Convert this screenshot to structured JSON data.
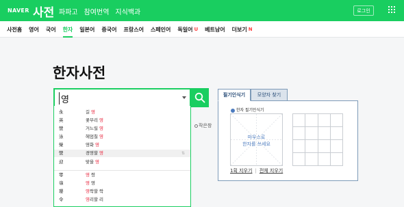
{
  "header": {
    "logo": "NAVER",
    "service": "사전",
    "nav": [
      "파파고",
      "참여번역",
      "지식백과"
    ],
    "login": "로그인"
  },
  "subnav": {
    "items": [
      {
        "label": "사전홈"
      },
      {
        "label": "영어"
      },
      {
        "label": "국어"
      },
      {
        "label": "한자",
        "active": true
      },
      {
        "label": "일본어"
      },
      {
        "label": "중국어"
      },
      {
        "label": "프랑스어"
      },
      {
        "label": "스페인어"
      },
      {
        "label": "독일어",
        "badge": "U"
      },
      {
        "label": "베트남어"
      },
      {
        "label": "더보기",
        "badge": "N"
      }
    ]
  },
  "main": {
    "title": "한자사전",
    "search": {
      "value": "영"
    },
    "side_note": "작은창"
  },
  "suggestions": [
    {
      "hanja": "永",
      "pre": "길 ",
      "hl": "영",
      "post": ""
    },
    {
      "hanja": "英",
      "pre": "꽃부리 ",
      "hl": "영",
      "post": ""
    },
    {
      "hanja": "營",
      "pre": "거느릴 ",
      "hl": "영",
      "post": ""
    },
    {
      "hanja": "泳",
      "pre": "헤엄칠 ",
      "hl": "영",
      "post": ""
    },
    {
      "hanja": "榮",
      "pre": "영화 ",
      "hl": "영",
      "post": ""
    },
    {
      "hanja": "營",
      "pre": "경영할 ",
      "hl": "영",
      "post": "",
      "selected": true
    },
    {
      "hanja": "迎",
      "pre": "맞을 ",
      "hl": "영",
      "post": ""
    },
    {
      "hanja": "零",
      "pre": "",
      "hl": "영",
      "post": " 령"
    },
    {
      "hanja": "嶺",
      "pre": "",
      "hl": "영",
      "post": " 영"
    },
    {
      "hanja": "瓔",
      "pre": "",
      "hl": "영",
      "post": "락할 락"
    },
    {
      "hanja": "令",
      "pre": "",
      "hl": "영",
      "post": "리할 리"
    }
  ],
  "handwriting": {
    "tab_active": "필기인식기",
    "tab_inactive": "모양자 찾기",
    "heading": "한자 필기인식기",
    "hint_line1": "마우스로",
    "hint_line2": "한자를 쓰세요",
    "clear_one": "1획 지우기",
    "clear_all": "전체 지우기"
  }
}
